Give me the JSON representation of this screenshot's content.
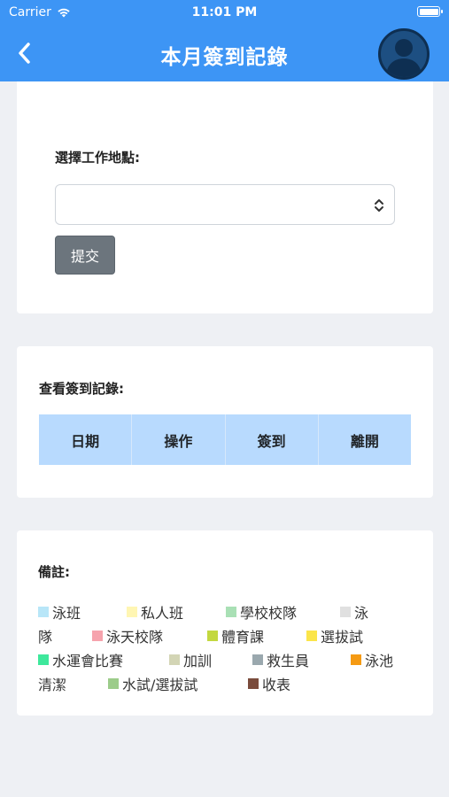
{
  "status": {
    "carrier": "Carrier",
    "time": "11:01 PM"
  },
  "navbar": {
    "title": "本月簽到記錄"
  },
  "form": {
    "label": "選擇工作地點:",
    "select_value": "",
    "submit_label": "提交"
  },
  "records": {
    "label": "查看簽到記錄:",
    "columns": [
      "日期",
      "操作",
      "簽到",
      "離開"
    ]
  },
  "notes": {
    "label": "備註:",
    "items": [
      {
        "label": " 泳班",
        "color": "#b8e6f8"
      },
      {
        "label": "私人班",
        "color": "#fff6b3"
      },
      {
        "label": "學校校隊",
        "color": "#a9e0b5"
      },
      {
        "label": "泳",
        "color": "#e0e0e0"
      },
      {
        "label": "隊",
        "color": ""
      },
      {
        "label": "泳天校隊",
        "color": "#f6a3ad"
      },
      {
        "label": "體育課",
        "color": "#c3d83f"
      },
      {
        "label": "選拔試",
        "color": "#fbe54a"
      },
      {
        "label": "水運會比賽",
        "color": "#3ee89c"
      },
      {
        "label": "加訓",
        "color": "#d3d5b5"
      },
      {
        "label": "救生員",
        "color": "#9aa8ae"
      },
      {
        "label": "泳池",
        "color": "#f59a13"
      },
      {
        "label": "清潔",
        "color": ""
      },
      {
        "label": "水試/選拔試",
        "color": "#9ccc8a"
      },
      {
        "label": "收表",
        "color": "#7a4b3c"
      }
    ]
  }
}
